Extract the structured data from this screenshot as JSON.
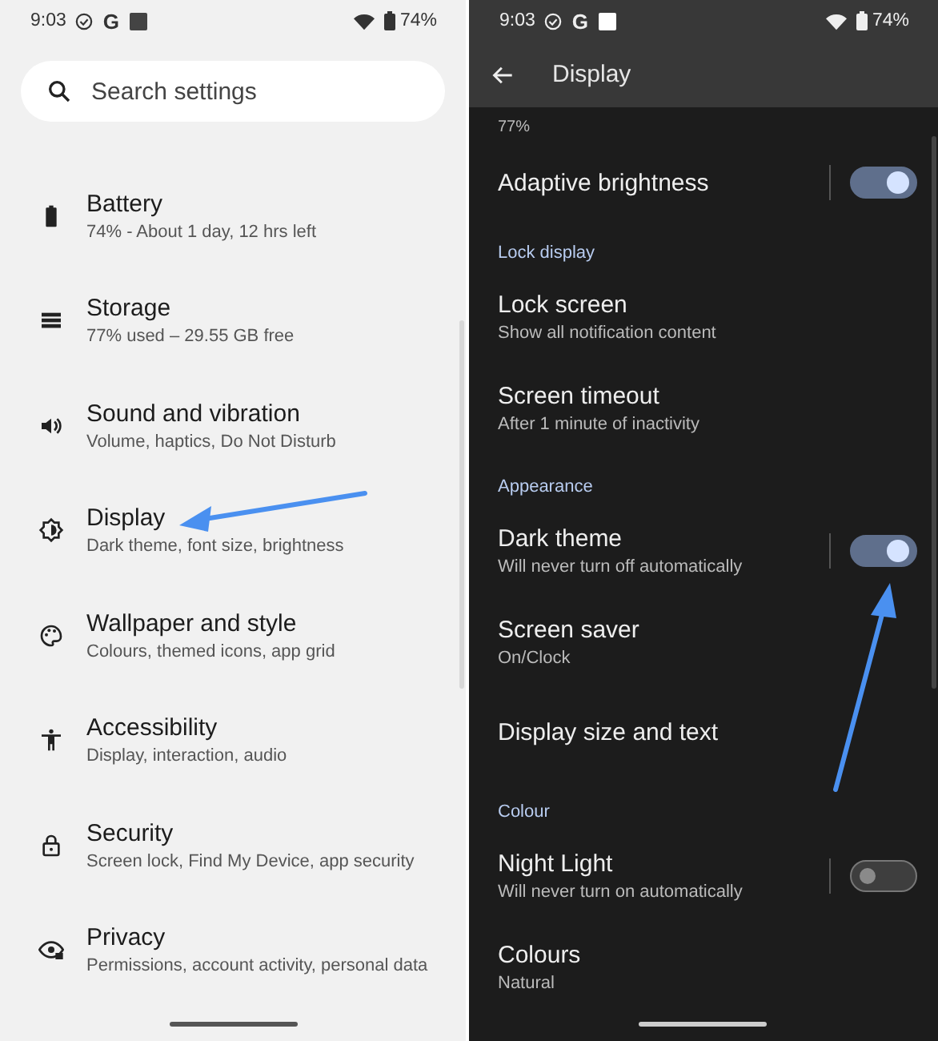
{
  "left": {
    "status_bar": {
      "time": "9:03",
      "g": "G",
      "battery": "74%"
    },
    "search": {
      "placeholder": "Search settings"
    },
    "items": [
      {
        "title": "Battery",
        "subtitle": "74% - About 1 day, 12 hrs left"
      },
      {
        "title": "Storage",
        "subtitle": "77% used – 29.55 GB free"
      },
      {
        "title": "Sound and vibration",
        "subtitle": "Volume, haptics, Do Not Disturb"
      },
      {
        "title": "Display",
        "subtitle": "Dark theme, font size, brightness"
      },
      {
        "title": "Wallpaper and style",
        "subtitle": "Colours, themed icons, app grid"
      },
      {
        "title": "Accessibility",
        "subtitle": "Display, interaction, audio"
      },
      {
        "title": "Security",
        "subtitle": "Screen lock, Find My Device, app security"
      },
      {
        "title": "Privacy",
        "subtitle": "Permissions, account activity, personal data"
      }
    ]
  },
  "right": {
    "status_bar": {
      "time": "9:03",
      "g": "G",
      "battery": "74%"
    },
    "title": "Display",
    "rows": [
      {
        "kind": "caption",
        "title": "77%"
      },
      {
        "kind": "toggle",
        "title": "Adaptive brightness",
        "on": true
      },
      {
        "kind": "header",
        "title": "Lock display"
      },
      {
        "kind": "setting",
        "title": "Lock screen",
        "subtitle": "Show all notification content"
      },
      {
        "kind": "setting",
        "title": "Screen timeout",
        "subtitle": "After 1 minute of inactivity"
      },
      {
        "kind": "header",
        "title": "Appearance"
      },
      {
        "kind": "toggle",
        "title": "Dark theme",
        "subtitle": "Will never turn off automatically",
        "on": true
      },
      {
        "kind": "setting",
        "title": "Screen saver",
        "subtitle": "On/Clock"
      },
      {
        "kind": "setting",
        "title": "Display size and text"
      },
      {
        "kind": "header",
        "title": "Colour"
      },
      {
        "kind": "toggle",
        "title": "Night Light",
        "subtitle": "Will never turn on automatically",
        "on": false
      },
      {
        "kind": "setting",
        "title": "Colours",
        "subtitle": "Natural"
      }
    ]
  }
}
